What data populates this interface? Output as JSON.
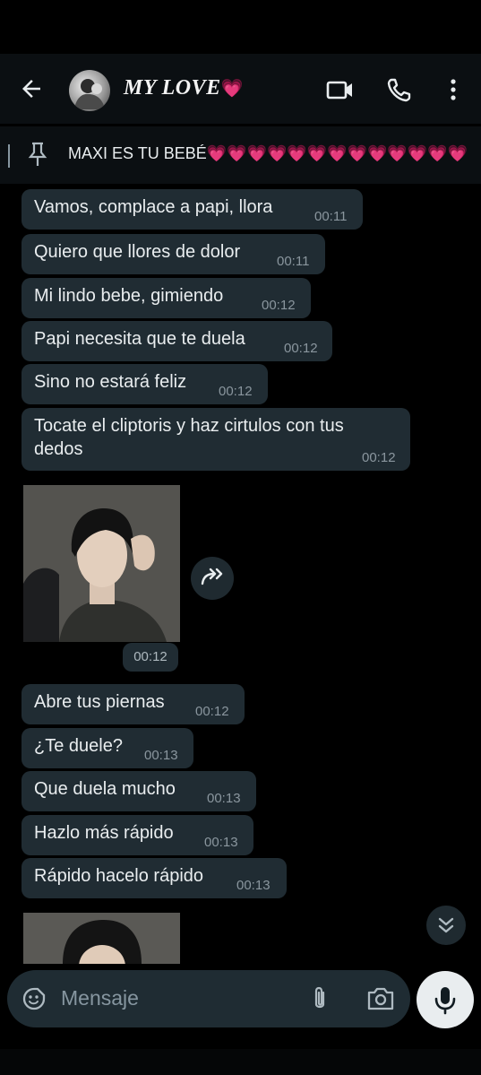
{
  "header": {
    "title": "MY LOVE",
    "title_emoji": "💗",
    "icons": [
      "back-arrow-icon",
      "avatar",
      "video-call-icon",
      "phone-icon",
      "more-vertical-icon"
    ]
  },
  "pinned": {
    "text": "MAXI ES TU BEBÉ💗💗💗💗💗💗💗💗💗💗💗💗💗..."
  },
  "messages": [
    {
      "text": "Vamos, complace a papi, llora",
      "time": "00:11"
    },
    {
      "text": "Quiero que llores de dolor",
      "time": "00:11"
    },
    {
      "text": "Mi lindo bebe, gimiendo",
      "time": "00:12"
    },
    {
      "text": "Papi necesita que te duela",
      "time": "00:12"
    },
    {
      "text": "Sino no estará feliz",
      "time": "00:12"
    },
    {
      "text_line1": "Tocate el cliptoris y haz cirtulos con tus",
      "text_line2": "dedos",
      "time": "00:12"
    },
    {
      "type": "image",
      "time": "00:12"
    },
    {
      "text": "Abre tus piernas",
      "time": "00:12"
    },
    {
      "text": "¿Te duele?",
      "time": "00:13"
    },
    {
      "text": "Que duela mucho",
      "time": "00:13"
    },
    {
      "text": "Hazlo más rápido",
      "time": "00:13"
    },
    {
      "text": "Rápido hacelo rápido",
      "time": "00:13"
    }
  ],
  "composer": {
    "placeholder": "Mensaje"
  },
  "colors": {
    "background": "#000000",
    "header": "#0b0f12",
    "bubble": "#202c33",
    "text": "#e9edef",
    "time": "#8a969e",
    "mic_button": "#e9edef"
  }
}
